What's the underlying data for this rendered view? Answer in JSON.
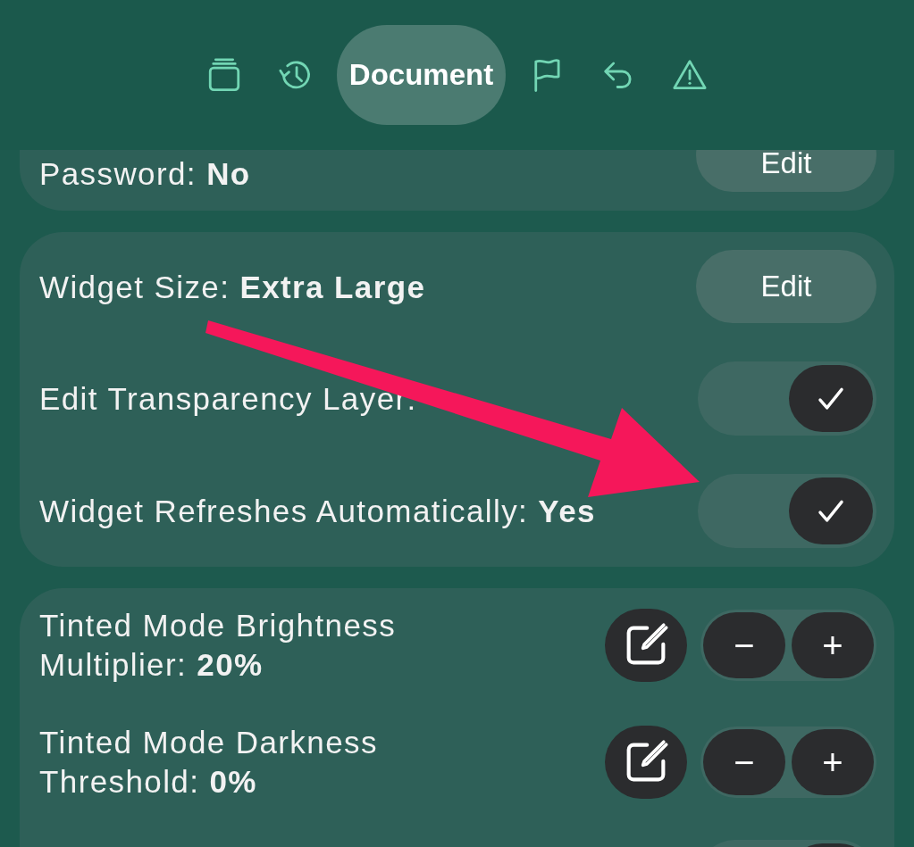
{
  "toolbar": {
    "tabs": [
      {
        "selected": false
      },
      {
        "selected": false
      },
      {
        "label": "Document",
        "selected": true
      },
      {
        "selected": false
      },
      {
        "selected": false
      },
      {
        "selected": false
      }
    ]
  },
  "cards": [
    {
      "rows": [
        {
          "kind": "button",
          "label": "Password: **No**",
          "button": "Edit"
        }
      ]
    },
    {
      "rows": [
        {
          "kind": "button",
          "label": "Widget Size: **Extra Large**",
          "button": "Edit"
        },
        {
          "kind": "toggle",
          "label": "Edit Transparency Layer:",
          "on": true
        },
        {
          "kind": "toggle",
          "label": "Widget Refreshes Automatically: **Yes**",
          "on": true
        }
      ]
    },
    {
      "rows": [
        {
          "kind": "stepper",
          "label": "Tinted Mode Brightness Multiplier: **20%**",
          "decrement": "−",
          "increment": "+"
        },
        {
          "kind": "stepper",
          "label": "Tinted Mode Darkness Threshold: **0%**",
          "decrement": "−",
          "increment": "+"
        },
        {
          "kind": "toggle",
          "on": true
        }
      ]
    }
  ]
}
